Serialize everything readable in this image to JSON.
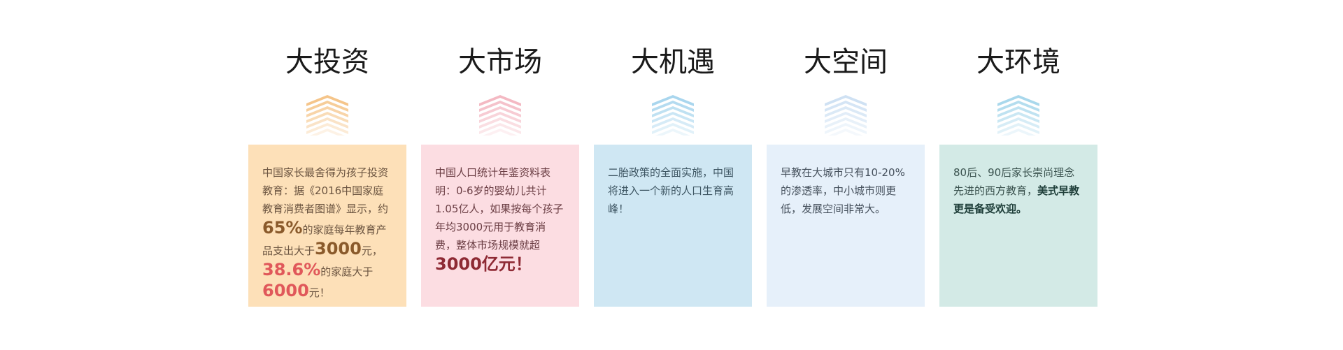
{
  "columns": [
    {
      "title": "大投资",
      "card_bg": "#fde0b8",
      "chevron_color": "#f5c58a",
      "text_color": "#5a4a3a",
      "segments": [
        {
          "text": "中国家长最舍得为孩子投资教育：据《2016中国家庭教育消费者图谱》显示，约",
          "style": "normal",
          "color": "#6b5440"
        },
        {
          "text": "65%",
          "style": "big",
          "color": "#8a5a2b"
        },
        {
          "text": "的家庭每年教育产品支出大于",
          "style": "normal",
          "color": "#6b5440"
        },
        {
          "text": "3000",
          "style": "big",
          "color": "#8a5a2b"
        },
        {
          "text": "元，",
          "style": "normal",
          "color": "#6b5440"
        },
        {
          "text": "38.6%",
          "style": "big",
          "color": "#e0585a"
        },
        {
          "text": "的家庭大于",
          "style": "normal",
          "color": "#6b5440"
        },
        {
          "text": "6000",
          "style": "big",
          "color": "#e0585a"
        },
        {
          "text": "元！",
          "style": "normal",
          "color": "#6b5440"
        }
      ]
    },
    {
      "title": "大市场",
      "card_bg": "#fcdde2",
      "chevron_color": "#f4b9c3",
      "text_color": "#6b3e44",
      "segments": [
        {
          "text": "中国人口统计年鉴资料表明：0-6岁的婴幼儿共计1.05亿人，如果按每个孩子年均3000元用于教育消费，整体市场规模就超",
          "style": "normal",
          "color": "#6b3e44"
        },
        {
          "text": "3000亿元！",
          "style": "big",
          "color": "#8e2a34"
        }
      ]
    },
    {
      "title": "大机遇",
      "card_bg": "#cfe7f3",
      "chevron_color": "#a9d6ee",
      "text_color": "#3d5562",
      "segments": [
        {
          "text": "二胎政策的全面实施，中国将进入一个新的人口生育高峰！",
          "style": "normal",
          "color": "#3d5562"
        }
      ]
    },
    {
      "title": "大空间",
      "card_bg": "#e6f0fa",
      "chevron_color": "#cfe1f3",
      "text_color": "#45505c",
      "segments": [
        {
          "text": "早教在大城市只有10-20%的渗透率，中小城市则更低，发展空间非常大。",
          "style": "normal",
          "color": "#45505c"
        }
      ]
    },
    {
      "title": "大环境",
      "card_bg": "#d3eae6",
      "chevron_color": "#a9d8ec",
      "text_color": "#2f4f4a",
      "segments": [
        {
          "text": "80后、90后家长崇尚理念先进的西方教育，",
          "style": "normal",
          "color": "#3a524e"
        },
        {
          "text": "美式早教更是备受欢迎。",
          "style": "bold",
          "color": "#1f3f3a"
        }
      ]
    }
  ]
}
